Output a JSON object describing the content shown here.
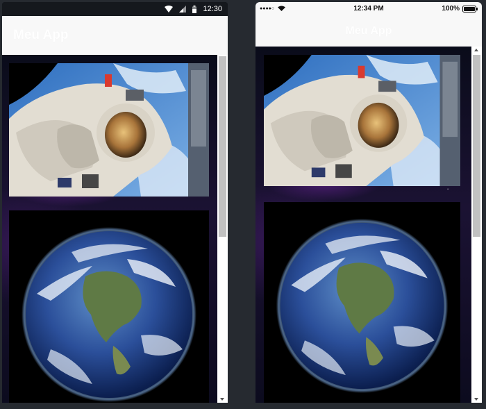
{
  "android": {
    "status_time": "12:30",
    "app_title": "Meu App",
    "icons": [
      "wifi-icon",
      "signal-icon",
      "battery-icon"
    ]
  },
  "ios": {
    "carrier_dots": "●●●●○",
    "status_time": "12:34 PM",
    "battery_percent": "100%",
    "app_title": "Meu App",
    "icons": [
      "signal-dots-icon",
      "wifi-icon",
      "battery-icon"
    ]
  },
  "images": {
    "astronaut": "astronaut-photo",
    "earth": "earth-photo"
  },
  "colors": {
    "statusbar_dark": "#15181d",
    "appbar": "#f8f8f8",
    "title": "#ffffff",
    "page_background": "#262a30"
  }
}
